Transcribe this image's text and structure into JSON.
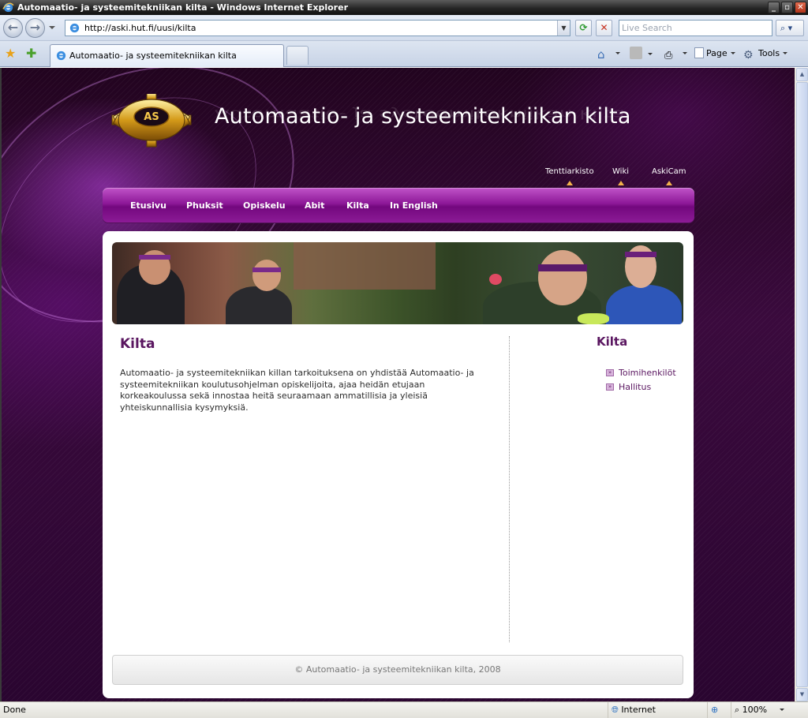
{
  "window": {
    "title": "Automaatio- ja systeemitekniikan kilta - Windows Internet Explorer",
    "minimize": "_",
    "maximize": "▫",
    "close": "✕"
  },
  "navbar": {
    "address": "http://aski.hut.fi/uusi/kilta",
    "search_placeholder": "Live Search"
  },
  "tabbar": {
    "active_tab": "Automaatio- ja systeemitekniikan kilta",
    "page_label": "Page",
    "tools_label": "Tools"
  },
  "site": {
    "title": "Automaatio- ja systeemitekniikan kilta",
    "logo_text": "AS",
    "toplinks": [
      "Tenttiarkisto",
      "Wiki",
      "AskiCam"
    ],
    "menu": [
      "Etusivu",
      "Phuksit",
      "Opiskelu",
      "Abit",
      "Kilta",
      "In English"
    ]
  },
  "main": {
    "title": "Kilta",
    "text": "Automaatio- ja systeemitekniikan killan tarkoituksena on yhdistää Automaatio- ja systeemitekniikan koulutusohjelman opiskelijoita, ajaa heidän etujaan korkeakoulussa sekä innostaa heitä seuraamaan ammatillisia ja yleisiä yhteiskunnallisia kysymyksiä."
  },
  "sidebar": {
    "title": "Kilta",
    "links": [
      "Toimihenkilöt",
      "Hallitus"
    ]
  },
  "footer": {
    "text": "© Automaatio- ja systeemitekniikan kilta, 2008"
  },
  "statusbar": {
    "status": "Done",
    "zone": "Internet",
    "zoom": "100%"
  },
  "colors": {
    "accent": "#8d1898",
    "heading": "#5a1660",
    "background": "#2a0530"
  }
}
